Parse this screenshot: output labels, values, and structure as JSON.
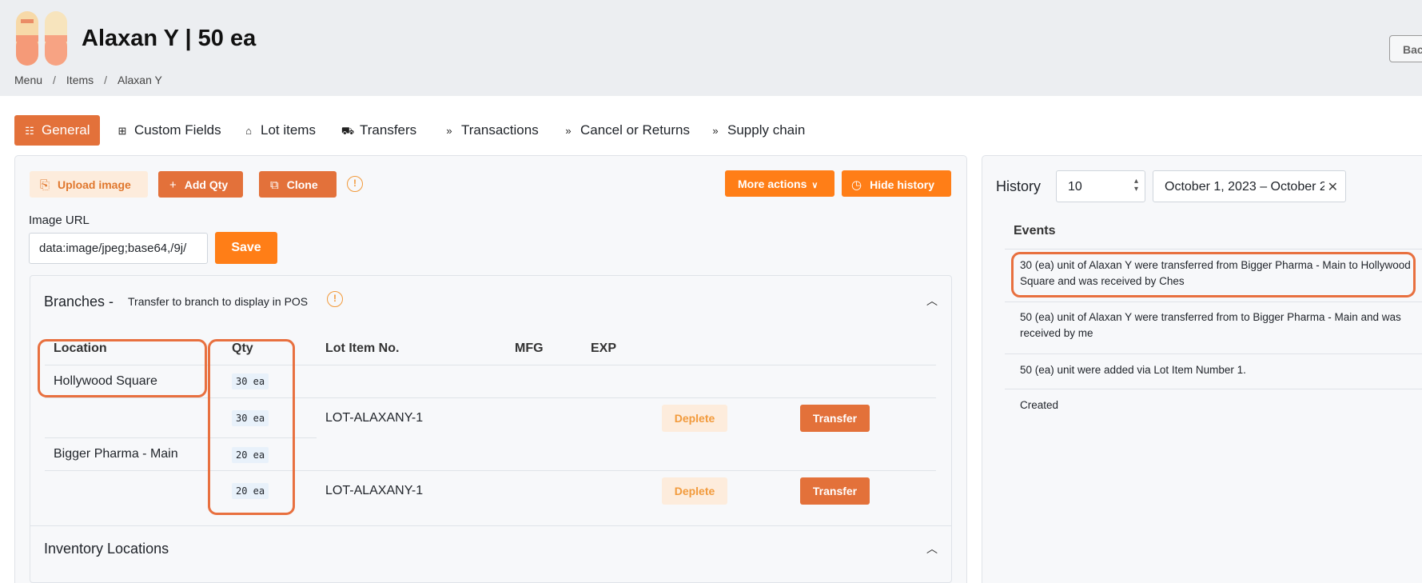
{
  "header": {
    "title": "Alaxan Y | 50 ea",
    "back_label": "Back",
    "breadcrumb": [
      "Menu",
      "Items",
      "Alaxan Y"
    ]
  },
  "tabs": [
    {
      "label": "General",
      "icon": "general-icon",
      "active": true
    },
    {
      "label": "Custom Fields",
      "icon": "table-icon",
      "active": false
    },
    {
      "label": "Lot items",
      "icon": "warehouse-icon",
      "active": false
    },
    {
      "label": "Transfers",
      "icon": "truck-icon",
      "active": false
    },
    {
      "label": "Transactions",
      "icon": "chevrons-right-icon",
      "active": false
    },
    {
      "label": "Cancel or Returns",
      "icon": "chevrons-right-icon",
      "active": false
    },
    {
      "label": "Supply chain",
      "icon": "chevrons-right-icon",
      "active": false
    }
  ],
  "toolbar": {
    "upload_label": "Upload image",
    "add_qty_label": "Add Qty",
    "clone_label": "Clone",
    "more_actions_label": "More actions",
    "hide_history_label": "Hide history"
  },
  "image_url": {
    "label": "Image URL",
    "value": "data:image/jpeg;base64,/9j/",
    "save_label": "Save"
  },
  "branches": {
    "title": "Branches -",
    "subtitle": "Transfer to branch to display in POS",
    "columns": [
      "Location",
      "Qty",
      "Lot Item No.",
      "MFG",
      "EXP"
    ],
    "rows": [
      {
        "location": "Hollywood Square",
        "qty": "30 ea",
        "lot": "LOT-ALAXANY-1",
        "lot_qty": "30 ea",
        "deplete": "Deplete",
        "transfer": "Transfer"
      },
      {
        "location": "Bigger Pharma - Main",
        "qty": "20 ea",
        "lot": "LOT-ALAXANY-1",
        "lot_qty": "20 ea",
        "deplete": "Deplete",
        "transfer": "Transfer"
      }
    ]
  },
  "inventory_locations": {
    "title": "Inventory Locations"
  },
  "history": {
    "title": "History",
    "page_size": "10",
    "date_range": "October 1, 2023 – October 2",
    "events_header": "Events",
    "events": [
      "30 (ea) unit of Alaxan Y were transferred from Bigger Pharma - Main to Hollywood Square and was received by Ches",
      "50 (ea) unit of Alaxan Y were transferred from to Bigger Pharma - Main and was received by me",
      "50 (ea) unit were added via Lot Item Number 1.",
      "Created"
    ]
  },
  "colors": {
    "accent": "#e3713a",
    "orange": "#ff7e17",
    "soft_orange": "#fdecdc",
    "highlight": "#e8703f"
  }
}
